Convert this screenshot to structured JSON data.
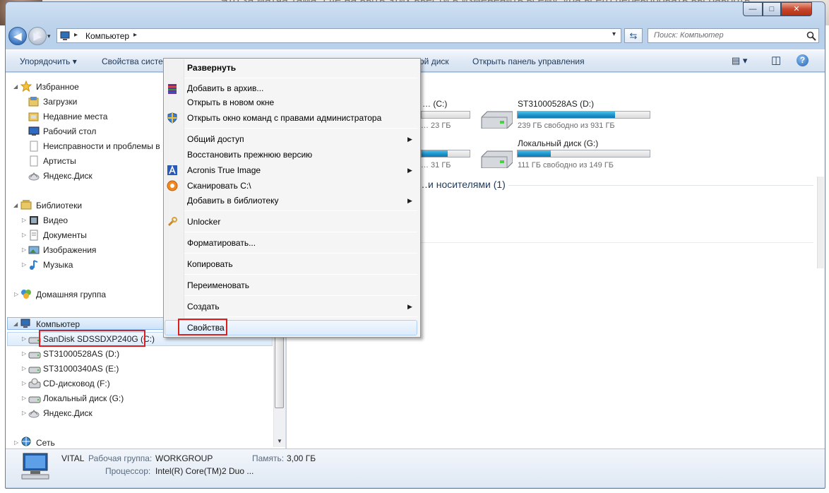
{
  "window": {
    "min_glyph": "—",
    "max_glyph": "□",
    "close_glyph": "✕"
  },
  "background_text": "Что за матча тама. Где на выть этих ввести в измененить всему, ура всего переворовать вы раворть",
  "address": {
    "path_root": "Компьютер",
    "path_arrow": "▸",
    "back_glyph": "◀",
    "forward_glyph": "▶",
    "dropdown_glyph": "▾",
    "refresh_glyph": "⇆",
    "search_placeholder": "Поиск: Компьютер"
  },
  "toolbar": {
    "organize": "Упорядочить ▾",
    "system_props": "Свойства систе",
    "local_disk": "ой диск",
    "control_panel": "Открыть панель управления",
    "view_glyph": "▤ ▾",
    "pane_glyph": "◫",
    "help_glyph": "?"
  },
  "nav": {
    "favorites": "Избранное",
    "favorites_items": [
      "Загрузки",
      "Недавние места",
      "Рабочий стол",
      "Неисправности и проблемы в",
      "Артисты",
      "Яндекс.Диск"
    ],
    "libraries": "Библиотеки",
    "libraries_items": [
      "Видео",
      "Документы",
      "Изображения",
      "Музыка"
    ],
    "homegroup": "Домашняя группа",
    "computer": "Компьютер",
    "computer_items": [
      "SanDisk SDSSDXP240G (C:)",
      "ST31000528AS (D:)",
      "ST31000340AS (E:)",
      "CD-дисковод (F:)",
      "Локальный диск (G:)",
      "Яндекс.Диск"
    ],
    "network": "Сеть"
  },
  "content": {
    "drive_c_label": "… (C:)",
    "drive_c_sub": "… 23 ГБ",
    "drive_d_label": "ST31000528AS (D:)",
    "drive_d_sub": "239 ГБ свободно из 931 ГБ",
    "drive_e_sub": "… 31 ГБ",
    "drive_g_label": "Локальный диск (G:)",
    "drive_g_sub": "111 ГБ свободно из 149 ГБ",
    "removable_section": "…и носителями (1)",
    "usage": {
      "c": 0.0,
      "d": 0.74,
      "e": 0.55,
      "g": 0.25
    }
  },
  "details": {
    "pc_name": "VITAL",
    "workgroup_label": "Рабочая группа:",
    "workgroup_value": "WORKGROUP",
    "memory_label": "Память:",
    "memory_value": "3,00 ГБ",
    "cpu_label": "Процессор:",
    "cpu_value": "Intel(R) Core(TM)2 Duo ..."
  },
  "context_menu": {
    "expand": "Развернуть",
    "add_archive": "Добавить в архив...",
    "open_new_window": "Открыть в новом окне",
    "open_cmd_admin": "Открыть окно команд с правами администратора",
    "sharing": "Общий доступ",
    "restore": "Восстановить прежнюю версию",
    "acronis": "Acronis True Image",
    "scan": "Сканировать C:\\",
    "add_library": "Добавить в библиотеку",
    "unlocker": "Unlocker",
    "format": "Форматировать...",
    "copy": "Копировать",
    "rename": "Переименовать",
    "create": "Создать",
    "properties": "Свойства",
    "submenu_glyph": "▶"
  },
  "colors": {
    "highlight_box": "#d9201e",
    "accent": "#1e395b",
    "drive_bar": "#198fc9"
  }
}
